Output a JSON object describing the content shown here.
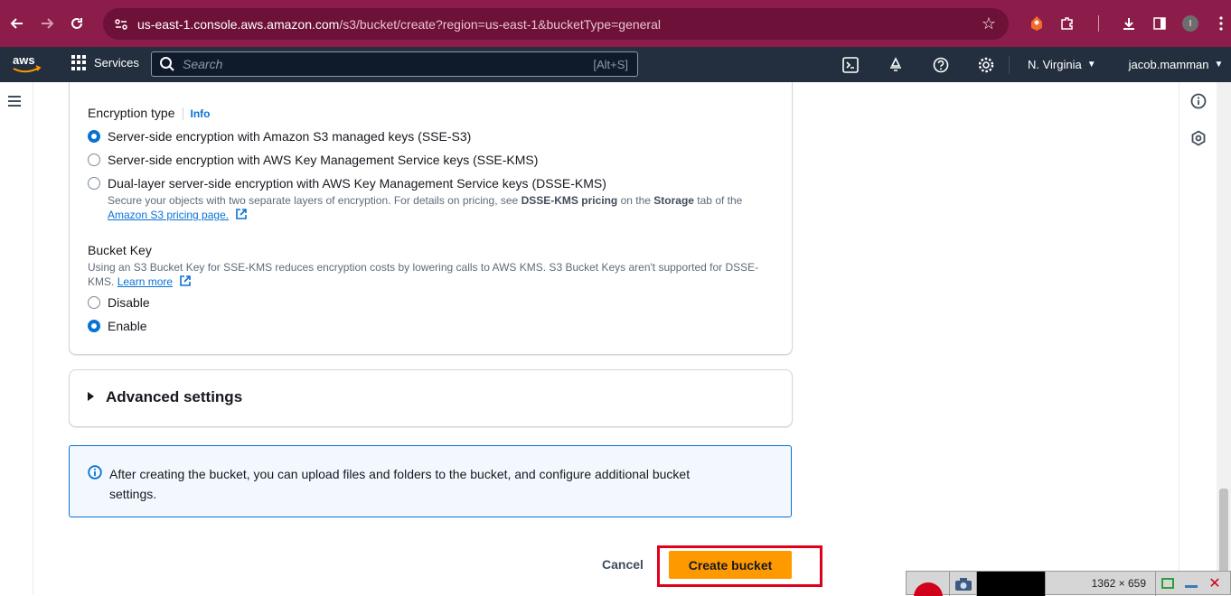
{
  "browser": {
    "url_host": "us-east-1.console.aws.amazon.com",
    "url_path": "/s3/bucket/create?region=us-east-1&bucketType=general",
    "profile_initial": "I"
  },
  "aws_nav": {
    "services_label": "Services",
    "search_placeholder": "Search",
    "search_shortcut": "[Alt+S]",
    "region": "N. Virginia",
    "user": "jacob.mamman"
  },
  "encryption": {
    "label": "Encryption type",
    "info": "Info",
    "options": [
      {
        "label": "Server-side encryption with Amazon S3 managed keys (SSE-S3)",
        "checked": true
      },
      {
        "label": "Server-side encryption with AWS Key Management Service keys (SSE-KMS)",
        "checked": false
      },
      {
        "label": "Dual-layer server-side encryption with AWS Key Management Service keys (DSSE-KMS)",
        "checked": false
      }
    ],
    "dsse_desc_1": "Secure your objects with two separate layers of encryption. For details on pricing, see ",
    "dsse_desc_bold1": "DSSE-KMS pricing",
    "dsse_desc_2": " on the ",
    "dsse_desc_bold2": "Storage",
    "dsse_desc_3": " tab of the",
    "dsse_link": "Amazon S3 pricing page."
  },
  "bucket_key": {
    "label": "Bucket Key",
    "desc_line1": "Using an S3 Bucket Key for SSE-KMS reduces encryption costs by lowering calls to AWS KMS. S3 Bucket Keys aren't supported for DSSE-",
    "desc_line2": "KMS.",
    "learn_more": "Learn more",
    "options": [
      {
        "label": "Disable",
        "checked": false
      },
      {
        "label": "Enable",
        "checked": true
      }
    ]
  },
  "advanced": {
    "title": "Advanced settings"
  },
  "alert": {
    "text": "After creating the bucket, you can upload files and folders to the bucket, and configure additional bucket settings."
  },
  "actions": {
    "cancel": "Cancel",
    "create": "Create bucket"
  },
  "recorder": {
    "dims": "1362 × 659"
  },
  "colors": {
    "browser_bar": "#8c1d4a",
    "aws_nav": "#232f3e",
    "primary_button": "#ff9900",
    "link": "#0972d3",
    "highlight": "#e0001a"
  }
}
